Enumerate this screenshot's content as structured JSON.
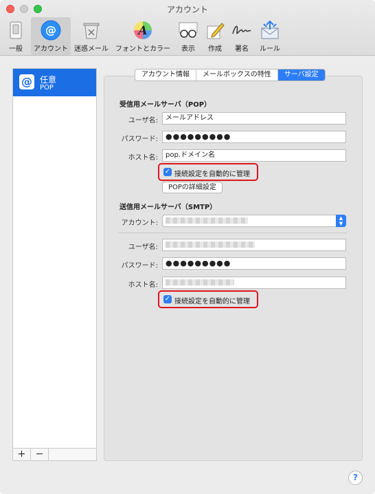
{
  "window": {
    "title": "アカウント"
  },
  "toolbar": {
    "items": [
      {
        "label": "一般",
        "icon": "general-switch-icon"
      },
      {
        "label": "アカウント",
        "icon": "at-sign-icon"
      },
      {
        "label": "迷惑メール",
        "icon": "junk-trash-icon"
      },
      {
        "label": "フォントとカラー",
        "icon": "font-color-icon"
      },
      {
        "label": "表示",
        "icon": "glasses-icon"
      },
      {
        "label": "作成",
        "icon": "pencil-paper-icon"
      },
      {
        "label": "署名",
        "icon": "signature-icon"
      },
      {
        "label": "ルール",
        "icon": "rules-envelope-icon"
      }
    ],
    "active": "アカウント"
  },
  "sidebar": {
    "account_name": "任意",
    "account_type": "POP",
    "add_label": "+",
    "remove_label": "−"
  },
  "tabs": [
    "アカウント情報",
    "メールボックスの特性",
    "サーバ設定"
  ],
  "active_tab": "サーバ設定",
  "incoming": {
    "title": "受信用メールサーバ（POP）",
    "username_label": "ユーザ名:",
    "username_value": "メールアドレス",
    "password_label": "パスワード:",
    "password_value": "●●●●●●●●●",
    "host_label": "ホスト名:",
    "host_value": "pop.ドメイン名",
    "auto_manage_label": "接続設定を自動的に管理",
    "auto_manage_checked": true,
    "advanced_button": "POPの詳細設定"
  },
  "outgoing": {
    "title": "送信用メールサーバ（SMTP）",
    "account_label": "アカウント:",
    "username_label": "ユーザ名:",
    "password_label": "パスワード:",
    "password_value": "●●●●●●●●●",
    "host_label": "ホスト名:",
    "auto_manage_label": "接続設定を自動的に管理",
    "auto_manage_checked": true
  },
  "help_label": "?",
  "colors": {
    "accent": "#2d7ef5",
    "highlight": "#e0141e",
    "selection": "#1b6ee4"
  }
}
